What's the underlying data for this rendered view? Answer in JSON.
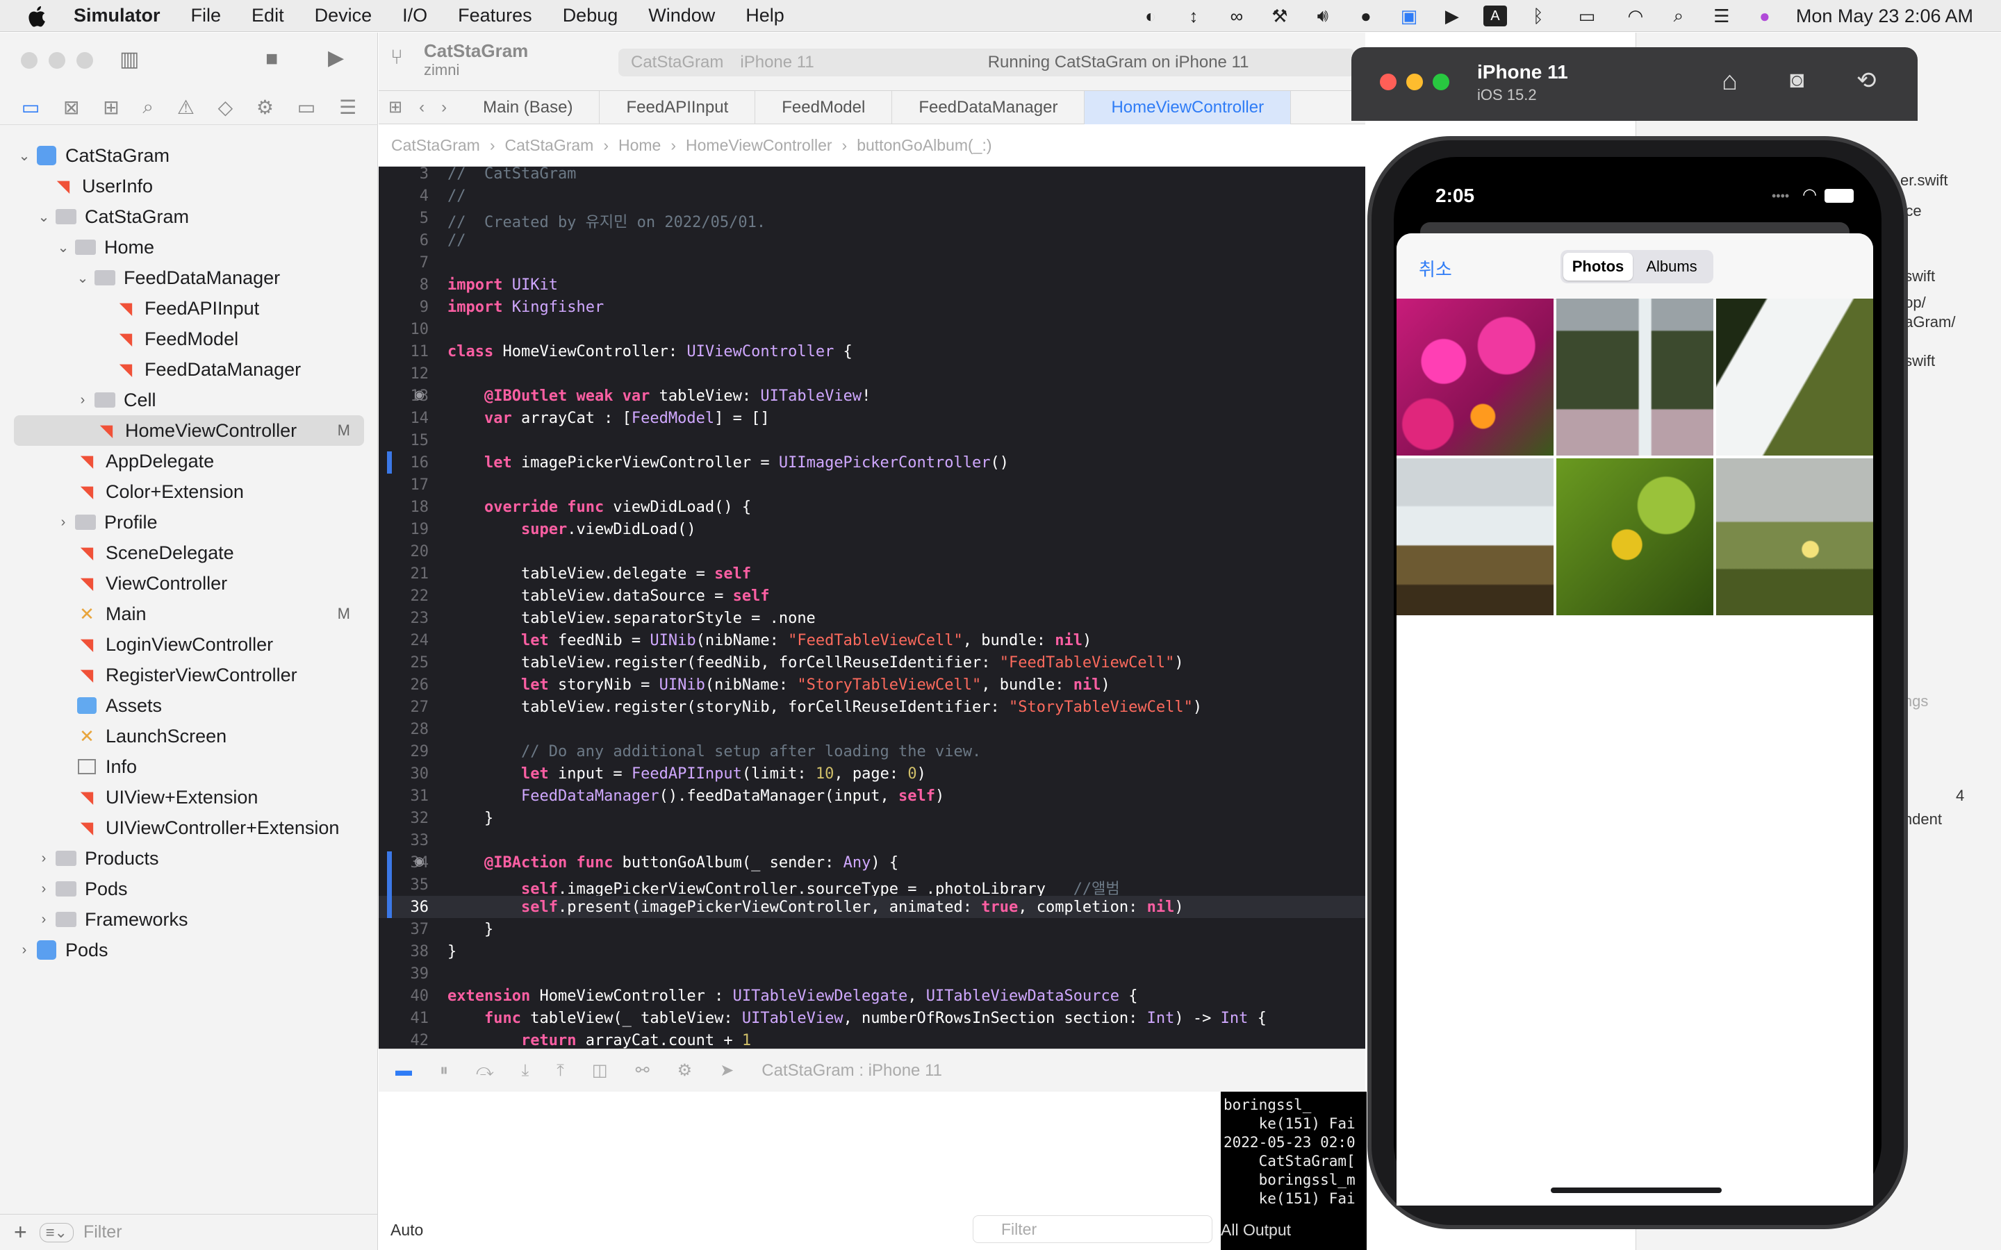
{
  "menubar": {
    "app_name": "Simulator",
    "items": [
      "File",
      "Edit",
      "Device",
      "I/O",
      "Features",
      "Debug",
      "Window",
      "Help"
    ],
    "datetime": "Mon May 23  2:06 AM"
  },
  "toolbar": {
    "project": "CatStaGram",
    "branch": "zimni",
    "scheme": "CatStaGram",
    "device": "iPhone 11",
    "status": "Running CatStaGram on iPhone 11"
  },
  "tabs": [
    "Main (Base)",
    "FeedAPIInput",
    "FeedModel",
    "FeedDataManager",
    "HomeViewController"
  ],
  "jumpbar": [
    "CatStaGram",
    "CatStaGram",
    "Home",
    "HomeViewController",
    "buttonGoAlbum(_:)"
  ],
  "navigator": {
    "items": [
      {
        "label": "CatStaGram",
        "badge": ""
      },
      {
        "label": "UserInfo",
        "badge": ""
      },
      {
        "label": "CatStaGram",
        "badge": ""
      },
      {
        "label": "Home",
        "badge": ""
      },
      {
        "label": "FeedDataManager",
        "badge": ""
      },
      {
        "label": "FeedAPIInput",
        "badge": ""
      },
      {
        "label": "FeedModel",
        "badge": ""
      },
      {
        "label": "FeedDataManager",
        "badge": ""
      },
      {
        "label": "Cell",
        "badge": ""
      },
      {
        "label": "HomeViewController",
        "badge": "M"
      },
      {
        "label": "AppDelegate",
        "badge": ""
      },
      {
        "label": "Color+Extension",
        "badge": ""
      },
      {
        "label": "Profile",
        "badge": ""
      },
      {
        "label": "SceneDelegate",
        "badge": ""
      },
      {
        "label": "ViewController",
        "badge": ""
      },
      {
        "label": "Main",
        "badge": "M"
      },
      {
        "label": "LoginViewController",
        "badge": ""
      },
      {
        "label": "RegisterViewController",
        "badge": ""
      },
      {
        "label": "Assets",
        "badge": ""
      },
      {
        "label": "LaunchScreen",
        "badge": ""
      },
      {
        "label": "Info",
        "badge": ""
      },
      {
        "label": "UIView+Extension",
        "badge": ""
      },
      {
        "label": "UIViewController+Extension",
        "badge": ""
      },
      {
        "label": "Products",
        "badge": ""
      },
      {
        "label": "Pods",
        "badge": ""
      },
      {
        "label": "Frameworks",
        "badge": ""
      },
      {
        "label": "Pods",
        "badge": ""
      }
    ],
    "filter_placeholder": "Filter"
  },
  "code": {
    "current_line": "36",
    "lines": [
      {
        "n": "3",
        "t": "//  CatStaGram"
      },
      {
        "n": "4",
        "t": "//"
      },
      {
        "n": "5",
        "t": "//  Created by 유지민 on 2022/05/01."
      },
      {
        "n": "6",
        "t": "//"
      },
      {
        "n": "7",
        "t": ""
      },
      {
        "n": "8",
        "t": "import UIKit"
      },
      {
        "n": "9",
        "t": "import Kingfisher"
      },
      {
        "n": "10",
        "t": ""
      },
      {
        "n": "11",
        "t": "class HomeViewController: UIViewController {"
      },
      {
        "n": "12",
        "t": ""
      },
      {
        "n": "13",
        "t": "    @IBOutlet weak var tableView: UITableView!"
      },
      {
        "n": "14",
        "t": "    var arrayCat : [FeedModel] = []"
      },
      {
        "n": "15",
        "t": ""
      },
      {
        "n": "16",
        "t": "    let imagePickerViewController = UIImagePickerController()"
      },
      {
        "n": "17",
        "t": ""
      },
      {
        "n": "18",
        "t": "    override func viewDidLoad() {"
      },
      {
        "n": "19",
        "t": "        super.viewDidLoad()"
      },
      {
        "n": "20",
        "t": ""
      },
      {
        "n": "21",
        "t": "        tableView.delegate = self"
      },
      {
        "n": "22",
        "t": "        tableView.dataSource = self"
      },
      {
        "n": "23",
        "t": "        tableView.separatorStyle = .none"
      },
      {
        "n": "24",
        "t": "        let feedNib = UINib(nibName: \"FeedTableViewCell\", bundle: nil)"
      },
      {
        "n": "25",
        "t": "        tableView.register(feedNib, forCellReuseIdentifier: \"FeedTableViewCell\")"
      },
      {
        "n": "26",
        "t": "        let storyNib = UINib(nibName: \"StoryTableViewCell\", bundle: nil)"
      },
      {
        "n": "27",
        "t": "        tableView.register(storyNib, forCellReuseIdentifier: \"StoryTableViewCell\")"
      },
      {
        "n": "28",
        "t": ""
      },
      {
        "n": "29",
        "t": "        // Do any additional setup after loading the view."
      },
      {
        "n": "30",
        "t": "        let input = FeedAPIInput(limit: 10, page: 0)"
      },
      {
        "n": "31",
        "t": "        FeedDataManager().feedDataManager(input, self)"
      },
      {
        "n": "32",
        "t": "    }"
      },
      {
        "n": "33",
        "t": ""
      },
      {
        "n": "34",
        "t": "    @IBAction func buttonGoAlbum(_ sender: Any) {"
      },
      {
        "n": "35",
        "t": "        self.imagePickerViewController.sourceType = .photoLibrary   //앨범"
      },
      {
        "n": "36",
        "t": "        self.present(imagePickerViewController, animated: true, completion: nil)"
      },
      {
        "n": "37",
        "t": "    }"
      },
      {
        "n": "38",
        "t": "}"
      },
      {
        "n": "39",
        "t": ""
      },
      {
        "n": "40",
        "t": "extension HomeViewController : UITableViewDelegate, UITableViewDataSource {"
      },
      {
        "n": "41",
        "t": "    func tableView(_ tableView: UITableView, numberOfRowsInSection section: Int) -> Int {"
      },
      {
        "n": "42",
        "t": "        return arrayCat.count + 1"
      }
    ]
  },
  "debug": {
    "target": "CatStaGram : iPhone 11",
    "auto_label": "Auto",
    "filter_placeholder": "Filter",
    "output_label": "All Output",
    "console_text": "boringssl_\n    ke(151) Fai\n2022-05-23 02:0\n    CatStaGram[\n    boringssl_m\n    ke(151) Fai"
  },
  "inspector": {
    "items": [
      "er.swift",
      "rce",
      ".swift",
      "top/",
      "taGram/",
      ".swift",
      "g",
      "ings",
      "4",
      "indent"
    ]
  },
  "simulator": {
    "device": "iPhone 11",
    "os": "iOS 15.2",
    "time": "2:05",
    "cancel_label": "취소",
    "segments": [
      "Photos",
      "Albums"
    ],
    "photos": [
      "pink-flowers",
      "waterfall-cliff",
      "waterfall-close",
      "waterfall-mist",
      "green-leaves",
      "meadow-flower"
    ]
  },
  "colors": {
    "accent": "#2f7cf6",
    "editor_bg": "#1f1f24",
    "keyword": "#fc5fa3",
    "type": "#d0a8ff",
    "string": "#fc6a5d",
    "comment": "#6c7986"
  }
}
